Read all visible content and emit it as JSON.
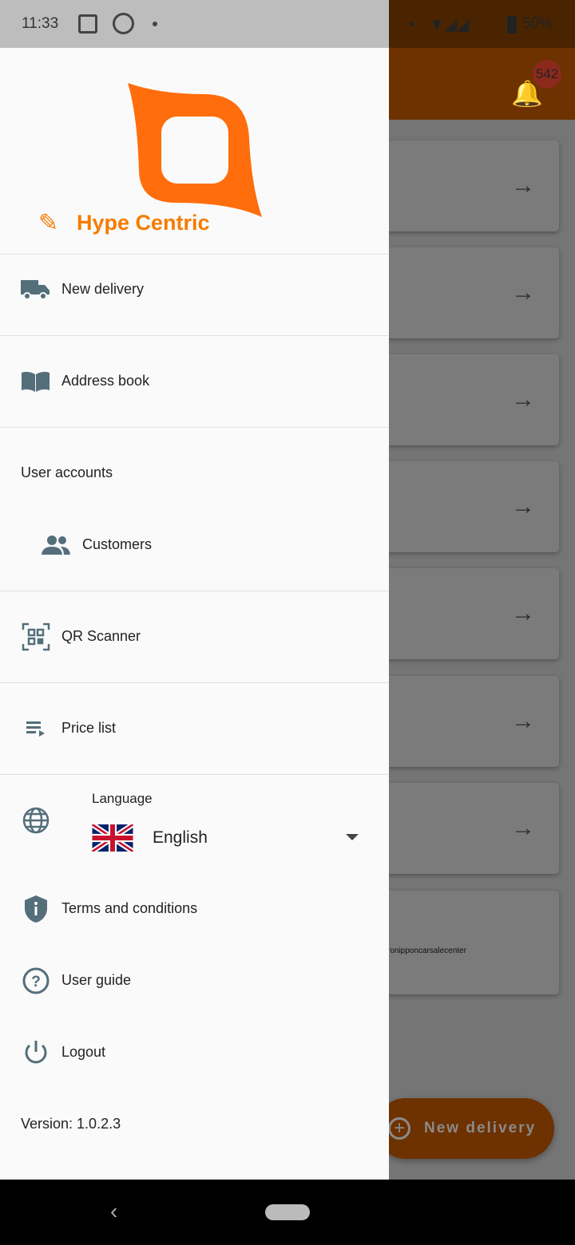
{
  "status_bar": {
    "time": "11:33",
    "battery": "50%"
  },
  "app_bar": {
    "notification_count": "542"
  },
  "background": {
    "card_text": "ronipponcarsalecenter",
    "fab_label": "New delivery",
    "card_count": 8
  },
  "drawer": {
    "brand": "Hype Centric",
    "items": [
      {
        "label": "New delivery",
        "icon": "truck-icon"
      },
      {
        "label": "Address book",
        "icon": "book-icon"
      },
      {
        "label": "User accounts"
      },
      {
        "label": "Customers",
        "icon": "people-icon"
      },
      {
        "label": "QR Scanner",
        "icon": "qr-icon"
      },
      {
        "label": "Price list",
        "icon": "list-icon"
      }
    ],
    "language": {
      "label": "Language",
      "value": "English"
    },
    "bottom_items": [
      {
        "label": "Terms and conditions",
        "icon": "shield-info-icon"
      },
      {
        "label": "User guide",
        "icon": "help-icon"
      },
      {
        "label": "Logout",
        "icon": "power-icon"
      }
    ],
    "version": "Version: 1.0.2.3"
  },
  "colors": {
    "accent": "#f57c00",
    "icon": "#546e7a"
  }
}
